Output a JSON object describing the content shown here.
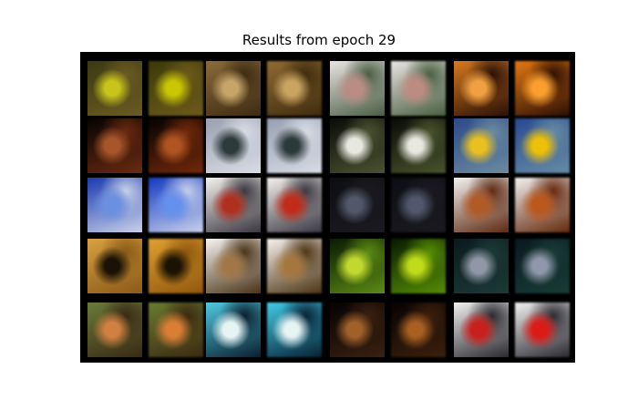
{
  "figure": {
    "title": "Results from epoch 29",
    "background_color": "#000000",
    "rows": 5,
    "pairs_per_row": 4,
    "tiles": [
      [
        "olive-yellow",
        "olive-yellow",
        "tan-brown",
        "tan-brown",
        "white-pink",
        "white-pink",
        "orange-dark",
        "orange-dark"
      ],
      [
        "dark-brown",
        "dark-brown",
        "gray-blue",
        "gray-blue",
        "dark-white",
        "dark-white",
        "blue-yellow",
        "blue-yellow"
      ],
      [
        "blue-sky",
        "blue-sky",
        "white-red",
        "white-red",
        "dark-gray",
        "dark-gray",
        "brown-white",
        "brown-white"
      ],
      [
        "orange-black",
        "orange-black",
        "tan-white",
        "tan-white",
        "dark-green",
        "dark-green",
        "dark-teal",
        "dark-teal"
      ],
      [
        "green-orange",
        "green-orange",
        "cyan-white",
        "cyan-white",
        "dark-amber",
        "dark-amber",
        "red-white",
        "red-white"
      ]
    ],
    "palettes": {
      "olive-yellow": [
        "#3a3a10",
        "#c8c41c",
        "#6b5a22"
      ],
      "tan-brown": [
        "#8b6b3a",
        "#c6a46a",
        "#3d2c12"
      ],
      "white-pink": [
        "#e9e4e2",
        "#b98c84",
        "#4a5e44"
      ],
      "orange-dark": [
        "#d67a20",
        "#f0a040",
        "#2a1006"
      ],
      "dark-brown": [
        "#050302",
        "#a6562a",
        "#6b2a10"
      ],
      "gray-blue": [
        "#9aa0b0",
        "#2c3a3a",
        "#d8dce4"
      ],
      "dark-white": [
        "#0a0c08",
        "#e8e8e0",
        "#4a5230"
      ],
      "blue-yellow": [
        "#2c4a88",
        "#e8c020",
        "#6a8aa0"
      ],
      "blue-sky": [
        "#1a3ab0",
        "#6a90e0",
        "#c8d0e8"
      ],
      "white-red": [
        "#f4f0ee",
        "#b03020",
        "#3a3840"
      ],
      "dark-gray": [
        "#0c0e12",
        "#52586a",
        "#1c1a20"
      ],
      "brown-white": [
        "#f2f0f0",
        "#b05a28",
        "#5e2a12"
      ],
      "orange-black": [
        "#d8a040",
        "#1a1204",
        "#8a5a18"
      ],
      "tan-white": [
        "#f6f2ee",
        "#a07848",
        "#4a3418"
      ],
      "dark-green": [
        "#0a1a04",
        "#c0d830",
        "#5a8a14"
      ],
      "dark-teal": [
        "#0a1a1e",
        "#9098a8",
        "#1c3a36"
      ],
      "green-orange": [
        "#6a7a3a",
        "#d08040",
        "#3a2a14"
      ],
      "cyan-white": [
        "#50c8e0",
        "#e8f4f4",
        "#0a2030"
      ],
      "dark-amber": [
        "#050302",
        "#a0602a",
        "#3a2010"
      ],
      "red-white": [
        "#f0f0f0",
        "#c8201c",
        "#2a2a30"
      ]
    }
  }
}
